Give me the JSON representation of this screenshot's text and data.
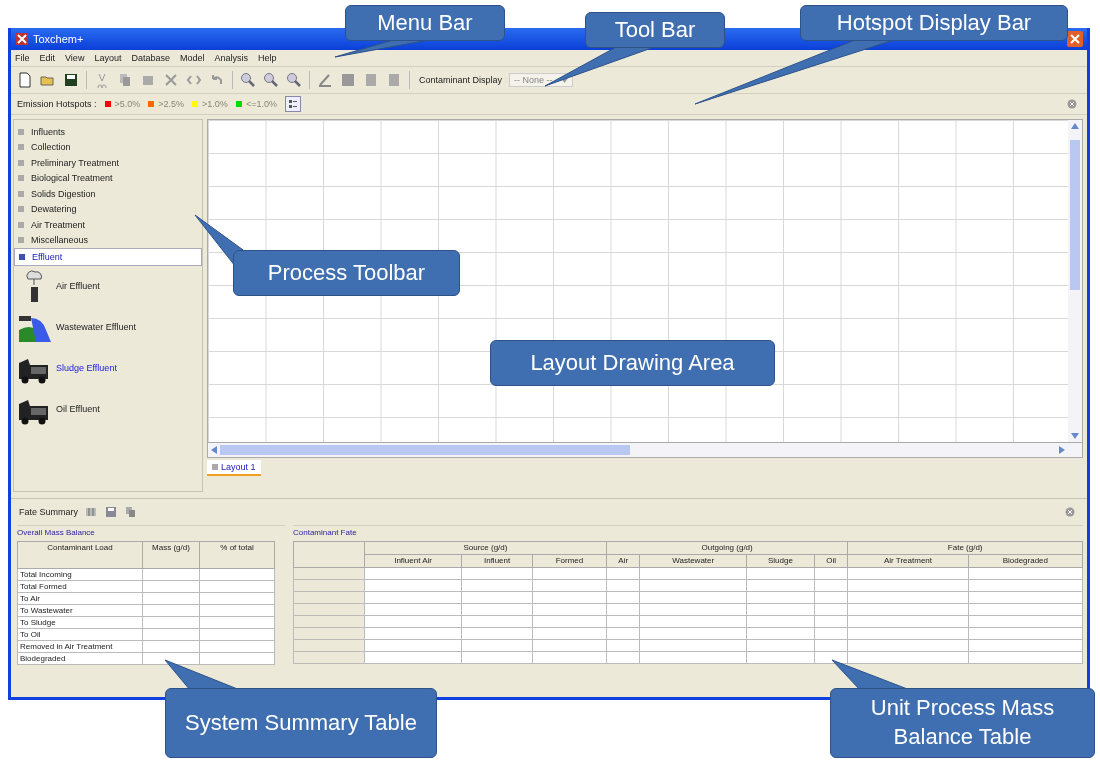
{
  "window": {
    "title": "Toxchem+"
  },
  "menu": [
    "File",
    "Edit",
    "View",
    "Layout",
    "Database",
    "Model",
    "Analysis",
    "Help"
  ],
  "toolbar": {
    "display_label": "Contaminant Display",
    "display_select": {
      "value": "-- None --",
      "disabled": true
    }
  },
  "hotspot_bar": {
    "label": "Emission Hotspots :",
    "legend": [
      {
        "label": ">5.0%",
        "color": "#ff0000"
      },
      {
        "label": ">2.5%",
        "color": "#ff6600"
      },
      {
        "label": ">1.0%",
        "color": "#ffff00"
      },
      {
        "label": "<=1.0%",
        "color": "#00dd00"
      }
    ]
  },
  "process_toolbar": {
    "categories": [
      {
        "label": "Influents",
        "selected": false
      },
      {
        "label": "Collection",
        "selected": false
      },
      {
        "label": "Preliminary Treatment",
        "selected": false
      },
      {
        "label": "Biological Treatment",
        "selected": false
      },
      {
        "label": "Solids Digestion",
        "selected": false
      },
      {
        "label": "Dewatering",
        "selected": false
      },
      {
        "label": "Air Treatment",
        "selected": false
      },
      {
        "label": "Miscellaneous",
        "selected": false
      },
      {
        "label": "Effluent",
        "selected": true
      }
    ],
    "items": [
      {
        "label": "Air Effluent",
        "kind": "air",
        "selected": false
      },
      {
        "label": "Wastewater Effluent",
        "kind": "wastewater",
        "selected": false
      },
      {
        "label": "Sludge Effluent",
        "kind": "sludge",
        "selected": true
      },
      {
        "label": "Oil Effluent",
        "kind": "oil",
        "selected": false
      }
    ]
  },
  "layout_tabs": [
    {
      "label": "Layout 1",
      "selected": true
    }
  ],
  "fate_summary": {
    "title": "Fate Summary",
    "overall_mass_balance": {
      "title": "Overall Mass Balance",
      "columns": [
        "Contaminant Load",
        "Mass (g/d)",
        "% of total"
      ],
      "rows": [
        "Total Incoming",
        "Total Formed",
        "To Air",
        "To Wastewater",
        "To Sludge",
        "To Oil",
        "Removed in Air Treatment",
        "Biodegraded"
      ]
    },
    "contaminant_fate": {
      "title": "Contaminant Fate",
      "groups": [
        {
          "label": "Source (g/d)",
          "columns": [
            "Influent Air",
            "Influent",
            "Formed"
          ]
        },
        {
          "label": "Outgoing (g/d)",
          "columns": [
            "Air",
            "Wastewater",
            "Sludge",
            "Oil"
          ]
        },
        {
          "label": "Fate (g/d)",
          "columns": [
            "Air Treatment",
            "Biodegraded"
          ]
        }
      ]
    }
  },
  "callouts": [
    {
      "text": "Menu Bar"
    },
    {
      "text": "Tool Bar"
    },
    {
      "text": "Hotspot Display Bar"
    },
    {
      "text": "Process Toolbar"
    },
    {
      "text": "Layout Drawing Area"
    },
    {
      "text": "System Summary Table"
    },
    {
      "text": "Unit Process Mass Balance Table"
    }
  ]
}
